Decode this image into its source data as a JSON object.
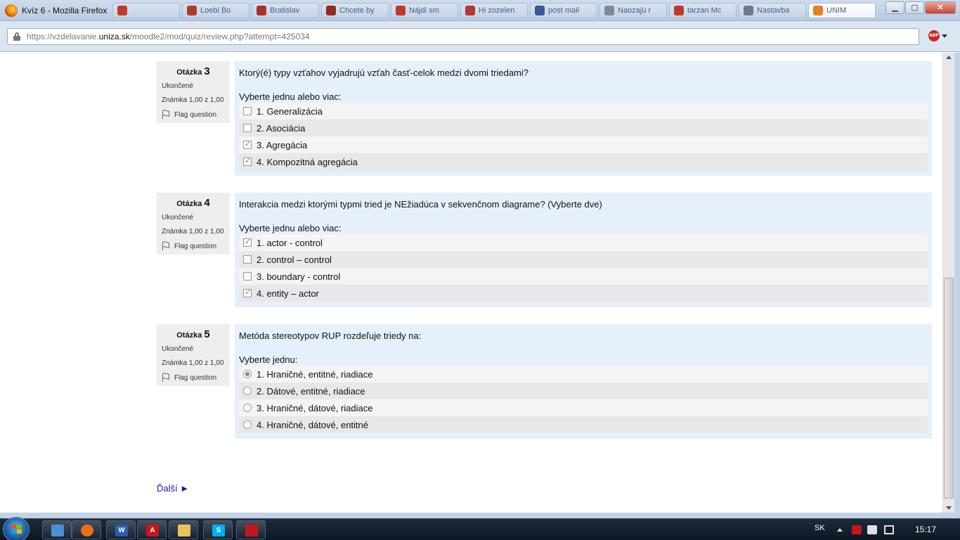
{
  "window": {
    "title": "Kvíz 6 - Mozilla Firefox",
    "controls": [
      "minimize",
      "maximize",
      "close"
    ]
  },
  "browser_tabs": [
    {
      "label": "",
      "favicon_color": "#c0392b"
    },
    {
      "label": "Loebi Bo",
      "favicon_color": "#b03a2e"
    },
    {
      "label": "Bratislav",
      "favicon_color": "#a93226"
    },
    {
      "label": "Chcete by",
      "favicon_color": "#922b21"
    },
    {
      "label": "Nájdi sm",
      "favicon_color": "#c0392b"
    },
    {
      "label": "Hi zozelen",
      "favicon_color": "#b03a2e"
    },
    {
      "label": "post mail",
      "favicon_color": "#3b5998"
    },
    {
      "label": "Naozajú r",
      "favicon_color": "#7d8a99"
    },
    {
      "label": "tarzan Mc",
      "favicon_color": "#c0392b"
    },
    {
      "label": "Nastavba",
      "favicon_color": "#6c7a89"
    },
    {
      "label": "UNIM",
      "favicon_color": "#e67e22",
      "active": true
    }
  ],
  "address_bar": {
    "url_prefix": "https://vzdelavanie.",
    "url_domain": "uniza.sk",
    "url_suffix": "/moodle2/mod/quiz/review.php?attempt=425034",
    "adblock_label": "ABP"
  },
  "questions": [
    {
      "label": "Otázka",
      "number": "3",
      "state": "Ukončené",
      "grade": "Známka 1,00 z 1,00",
      "flag_label": "Flag question",
      "text": "Ktorý(é) typy vzťahov vyjadrujú vzťah časť-celok medzi dvomi triedami?",
      "prompt": "Vyberte jednu alebo viac:",
      "input_type": "checkbox",
      "answers": [
        {
          "label": "1. Generalizácia",
          "checked": false
        },
        {
          "label": "2. Asociácia",
          "checked": false
        },
        {
          "label": "3. Agregácia",
          "checked": true
        },
        {
          "label": "4. Kompozitná agregácia",
          "checked": true
        }
      ]
    },
    {
      "label": "Otázka",
      "number": "4",
      "state": "Ukončené",
      "grade": "Známka 1,00 z 1,00",
      "flag_label": "Flag question",
      "text": "Interakcia medzi ktorými typmi tried je NEžiadúca v sekvenčnom diagrame? (Vyberte dve)",
      "prompt": "Vyberte jednu alebo viac:",
      "input_type": "checkbox",
      "answers": [
        {
          "label": "1. actor - control",
          "checked": true
        },
        {
          "label": "2. control – control",
          "checked": false
        },
        {
          "label": "3. boundary - control",
          "checked": false
        },
        {
          "label": "4. entity – actor",
          "checked": true
        }
      ]
    },
    {
      "label": "Otázka",
      "number": "5",
      "state": "Ukončené",
      "grade": "Známka 1,00 z 1,00",
      "flag_label": "Flag question",
      "text": "Metóda stereotypov RUP rozdeľuje triedy na:",
      "prompt": "Vyberte jednu:",
      "input_type": "radio",
      "answers": [
        {
          "label": "1. Hraničné, entitné, riadiace",
          "checked": true
        },
        {
          "label": "2. Dátové, entitné, riadiace",
          "checked": false
        },
        {
          "label": "3. Hraničné, dátové, riadiace",
          "checked": false
        },
        {
          "label": "4. Hraničné, dátové, entitné",
          "checked": false
        }
      ]
    }
  ],
  "navigation": {
    "next_label": "Ďalší ►"
  },
  "taskbar": {
    "pinned": [
      {
        "name": "show-windows",
        "color": "#4a90d9",
        "glyph": ""
      },
      {
        "name": "firefox",
        "color": "#e8711d",
        "glyph": ""
      },
      {
        "name": "word",
        "color": "#2a5caa",
        "glyph": "W"
      },
      {
        "name": "acrobat",
        "color": "#c4161c",
        "glyph": "A"
      },
      {
        "name": "explorer",
        "color": "#e8c25a",
        "glyph": ""
      },
      {
        "name": "skype",
        "color": "#00aff0",
        "glyph": "S"
      },
      {
        "name": "app",
        "color": "#c4161c",
        "glyph": ""
      }
    ],
    "language": "SK",
    "clock": "15:17"
  }
}
